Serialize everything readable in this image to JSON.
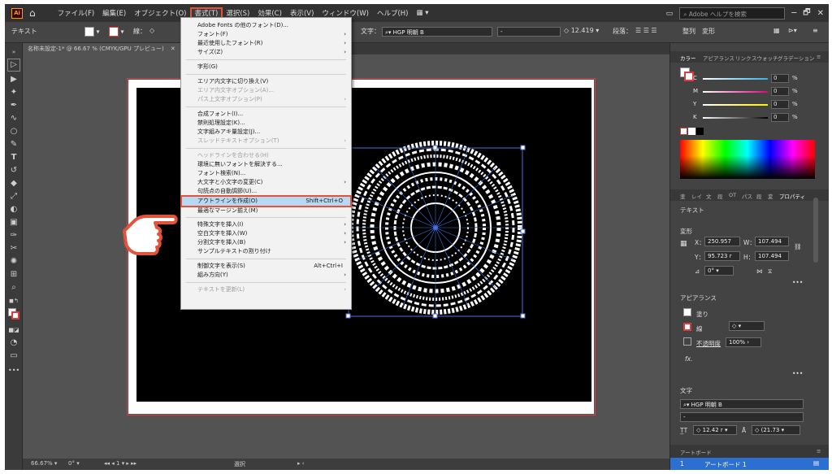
{
  "menubar": {
    "app_logo": "Ai",
    "items": [
      "ファイル(F)",
      "編集(E)",
      "オブジェクト(O)",
      "書式(T)",
      "選択(S)",
      "効果(C)",
      "表示(V)",
      "ウィンドウ(W)",
      "ヘルプ(H)"
    ],
    "workspace_icon": "grid-icon",
    "search_placeholder": "Adobe ヘルプを検索",
    "window_buttons": [
      "─",
      "🗗",
      "✕"
    ]
  },
  "controlbar": {
    "selection_type": "テキスト",
    "stroke_label": "線：",
    "char_label": "文字：",
    "font_name": "HGP 明朝 B",
    "font_style": "-",
    "font_size": "12.419",
    "paragraph_label": "段落：",
    "align_label": "整列",
    "transform_label": "変形"
  },
  "document_tab": {
    "title": "名称未設定-1* @ 66.67 % (CMYK/GPU プレビュー)",
    "close": "✕"
  },
  "format_menu": {
    "items": [
      {
        "label": "Adobe Fonts の他のフォント(D)...",
        "disabled": false
      },
      {
        "label": "フォント(F)",
        "submenu": true
      },
      {
        "label": "最近使用したフォント(R)",
        "submenu": true
      },
      {
        "label": "サイズ(Z)",
        "submenu": true
      },
      {
        "label": "字形(G)"
      },
      {
        "label": "エリア内文字に切り換え(V)"
      },
      {
        "label": "エリア内文字オプション(A)...",
        "disabled": true
      },
      {
        "label": "パス上文字オプション(P)",
        "disabled": true,
        "submenu": true
      },
      {
        "label": "合成フォント(I)..."
      },
      {
        "label": "禁則処理設定(K)..."
      },
      {
        "label": "文字組みアキ量設定(J)..."
      },
      {
        "label": "スレッドテキストオプション(T)",
        "disabled": true,
        "submenu": true
      },
      {
        "label": "ヘッドラインを合わせる(H)",
        "disabled": true
      },
      {
        "label": "環境に無いフォントを解決する..."
      },
      {
        "label": "フォント検索(N)..."
      },
      {
        "label": "大文字と小文字の変更(C)",
        "submenu": true
      },
      {
        "label": "句読点の自動調節(U)..."
      },
      {
        "label": "アウトラインを作成(O)",
        "shortcut": "Shift+Ctrl+O",
        "highlighted": true
      },
      {
        "label": "最適なマージン揃え(M)"
      },
      {
        "label": "特殊文字を挿入(I)",
        "submenu": true
      },
      {
        "label": "空白文字を挿入(W)",
        "submenu": true
      },
      {
        "label": "分割文字を挿入(B)",
        "submenu": true
      },
      {
        "label": "サンプルテキストの割り付け"
      },
      {
        "label": "制御文字を表示(S)",
        "shortcut": "Alt+Ctrl+I"
      },
      {
        "label": "組み方向(Y)",
        "submenu": true
      },
      {
        "label": "テキストを更新(L)",
        "disabled": true,
        "submenu": true
      }
    ]
  },
  "color_panel": {
    "tabs": [
      "カラー",
      "アピアランス",
      "リンク",
      "スウォッチ",
      "グラデーション"
    ],
    "channels": [
      {
        "label": "C",
        "value": "0",
        "unit": "%"
      },
      {
        "label": "M",
        "value": "0",
        "unit": "%"
      },
      {
        "label": "Y",
        "value": "0",
        "unit": "%"
      },
      {
        "label": "K",
        "value": "0",
        "unit": "%"
      }
    ]
  },
  "properties_panel": {
    "tabs": [
      "塗",
      "レイ",
      "文",
      "段",
      "OT",
      "パス",
      "段",
      "変",
      "プロパティ"
    ],
    "section_text": "テキスト",
    "section_transform": "変形",
    "x_label": "X：",
    "x_value": "250.957",
    "y_label": "Y：",
    "y_value": "95.723 r",
    "w_label": "W：",
    "w_value": "107.494",
    "h_label": "H：",
    "h_value": "107.494",
    "angle_value": "0°",
    "section_appearance": "アピアランス",
    "fill_label": "塗り",
    "stroke_label": "線",
    "opacity_label": "不透明度",
    "opacity_value": "100%",
    "fx_label": "fx.",
    "section_char": "文字",
    "font_name": "HGP 明朝 B",
    "font_style": "-",
    "font_size": "12.42 r",
    "leading": "(21.73",
    "more": "•••"
  },
  "artboard_panel": {
    "title": "アートボード",
    "index": "1",
    "name": "アートボード 1"
  },
  "statusbar": {
    "zoom": "66.67%",
    "rotation": "0°",
    "artboard_nav": "1",
    "tool": "選択"
  },
  "colors": {
    "highlight_outline": "#e2533a",
    "menu_highlight": "#b8d7f0",
    "selection_blue": "#4d6fd8",
    "app_bg": "#535353"
  }
}
